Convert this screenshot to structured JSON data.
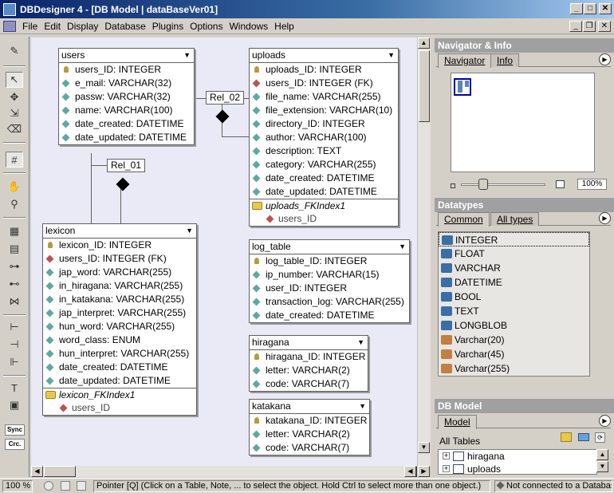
{
  "window": {
    "title": "DBDesigner 4 - [DB Model | dataBaseVer01]"
  },
  "menu": [
    "File",
    "Edit",
    "Display",
    "Database",
    "Plugins",
    "Options",
    "Windows",
    "Help"
  ],
  "toolbox": {
    "sync_label": "Sync",
    "crc_label": "Crc."
  },
  "entities": {
    "users": {
      "name": "users",
      "columns": [
        {
          "text": "users_ID: INTEGER",
          "kind": "key"
        },
        {
          "text": "e_mail: VARCHAR(32)",
          "kind": "attr"
        },
        {
          "text": "passw: VARCHAR(32)",
          "kind": "attr"
        },
        {
          "text": "name: VARCHAR(100)",
          "kind": "attr"
        },
        {
          "text": "date_created: DATETIME",
          "kind": "attr"
        },
        {
          "text": "date_updated: DATETIME",
          "kind": "attr"
        }
      ]
    },
    "uploads": {
      "name": "uploads",
      "columns": [
        {
          "text": "uploads_ID: INTEGER",
          "kind": "key"
        },
        {
          "text": "users_ID: INTEGER (FK)",
          "kind": "fk"
        },
        {
          "text": "file_name: VARCHAR(255)",
          "kind": "attr"
        },
        {
          "text": "file_extension: VARCHAR(10)",
          "kind": "attr"
        },
        {
          "text": "directory_ID: INTEGER",
          "kind": "attr"
        },
        {
          "text": "author: VARCHAR(100)",
          "kind": "attr"
        },
        {
          "text": "description: TEXT",
          "kind": "attr"
        },
        {
          "text": "category: VARCHAR(255)",
          "kind": "attr"
        },
        {
          "text": "date_created: DATETIME",
          "kind": "attr"
        },
        {
          "text": "date_updated: DATETIME",
          "kind": "attr"
        }
      ],
      "index": "uploads_FKIndex1",
      "index_cols": [
        "users_ID"
      ]
    },
    "lexicon": {
      "name": "lexicon",
      "columns": [
        {
          "text": "lexicon_ID: INTEGER",
          "kind": "key"
        },
        {
          "text": "users_ID: INTEGER (FK)",
          "kind": "fk"
        },
        {
          "text": "jap_word: VARCHAR(255)",
          "kind": "attr"
        },
        {
          "text": "in_hiragana: VARCHAR(255)",
          "kind": "attr"
        },
        {
          "text": "in_katakana: VARCHAR(255)",
          "kind": "attr"
        },
        {
          "text": "jap_interpret: VARCHAR(255)",
          "kind": "attr"
        },
        {
          "text": "hun_word: VARCHAR(255)",
          "kind": "attr"
        },
        {
          "text": "word_class: ENUM",
          "kind": "attr"
        },
        {
          "text": "hun_interpret: VARCHAR(255)",
          "kind": "attr"
        },
        {
          "text": "date_created: DATETIME",
          "kind": "attr"
        },
        {
          "text": "date_updated: DATETIME",
          "kind": "attr"
        }
      ],
      "index": "lexicon_FKIndex1",
      "index_cols": [
        "users_ID"
      ]
    },
    "log_table": {
      "name": "log_table",
      "columns": [
        {
          "text": "log_table_ID: INTEGER",
          "kind": "key"
        },
        {
          "text": "ip_number: VARCHAR(15)",
          "kind": "attr"
        },
        {
          "text": "user_ID: INTEGER",
          "kind": "attr"
        },
        {
          "text": "transaction_log: VARCHAR(255)",
          "kind": "attr"
        },
        {
          "text": "date_created: DATETIME",
          "kind": "attr"
        }
      ]
    },
    "hiragana": {
      "name": "hiragana",
      "columns": [
        {
          "text": "hiragana_ID: INTEGER",
          "kind": "key"
        },
        {
          "text": "letter: VARCHAR(2)",
          "kind": "attr"
        },
        {
          "text": "code: VARCHAR(7)",
          "kind": "attr"
        }
      ]
    },
    "katakana": {
      "name": "katakana",
      "columns": [
        {
          "text": "katakana_ID: INTEGER",
          "kind": "key"
        },
        {
          "text": "letter: VARCHAR(2)",
          "kind": "attr"
        },
        {
          "text": "code: VARCHAR(7)",
          "kind": "attr"
        }
      ]
    }
  },
  "relations": {
    "rel01": "Rel_01",
    "rel02": "Rel_02"
  },
  "navigator": {
    "title": "Navigator & Info",
    "tab_navigator": "Navigator",
    "tab_info": "Info",
    "zoom": "100%"
  },
  "datatypes": {
    "title": "Datatypes",
    "tab_common": "Common",
    "tab_all": "All types",
    "items": [
      {
        "label": "INTEGER",
        "color": "#3a6ea5"
      },
      {
        "label": "FLOAT",
        "color": "#3a6ea5"
      },
      {
        "label": "VARCHAR",
        "color": "#3a6ea5"
      },
      {
        "label": "DATETIME",
        "color": "#3a6ea5"
      },
      {
        "label": "BOOL",
        "color": "#3a6ea5"
      },
      {
        "label": "TEXT",
        "color": "#3a6ea5"
      },
      {
        "label": "LONGBLOB",
        "color": "#3a6ea5"
      },
      {
        "label": "Varchar(20)",
        "color": "#c08040"
      },
      {
        "label": "Varchar(45)",
        "color": "#c08040"
      },
      {
        "label": "Varchar(255)",
        "color": "#c08040"
      }
    ]
  },
  "dbmodel": {
    "title": "DB Model",
    "tab_model": "Model",
    "all_tables": "All Tables",
    "tables": [
      "hiragana",
      "uploads"
    ]
  },
  "status": {
    "zoom": "100 %",
    "hint": "Pointer [Q] (Click on a Table, Note, ... to select the object. Hold Ctrl to select more than one object.)",
    "connection": "Not connected to a Database"
  }
}
